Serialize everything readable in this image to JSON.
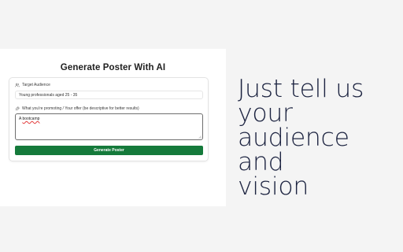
{
  "form": {
    "title": "Generate Poster With AI",
    "audience": {
      "label": "Target Audience",
      "icon": "users-icon",
      "value": "Young professionals aged 25 - 35"
    },
    "promotion": {
      "label": "What you're promoting / Your offer (be descriptive for better results)",
      "icon": "rocket-icon",
      "value_prefix": "A ",
      "value_word": "bootcamp"
    },
    "submit_label": "Generate Poster",
    "accent_color": "#157a3b"
  },
  "hero": {
    "lines": [
      "Just tell us",
      "your",
      "audience and",
      "vision"
    ],
    "color": "#1c2340"
  }
}
